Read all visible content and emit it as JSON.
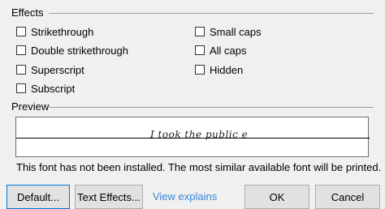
{
  "effects": {
    "label": "Effects",
    "left_options": [
      {
        "label": "Strikethrough",
        "checked": false
      },
      {
        "label": "Double strikethrough",
        "checked": false
      },
      {
        "label": "Superscript",
        "checked": false
      },
      {
        "label": "Subscript",
        "checked": false
      }
    ],
    "right_options": [
      {
        "label": "Small caps",
        "checked": false
      },
      {
        "label": "All caps",
        "checked": false
      },
      {
        "label": "Hidden",
        "checked": false
      }
    ]
  },
  "preview": {
    "label": "Preview",
    "sample_text": "I took the public e"
  },
  "info": "This font has not been installed. The most similar available font will be printed.",
  "buttons": {
    "default": "Default...",
    "text_effects": "Text Effects...",
    "view_explains": "View explains",
    "ok": "OK",
    "cancel": "Cancel"
  }
}
